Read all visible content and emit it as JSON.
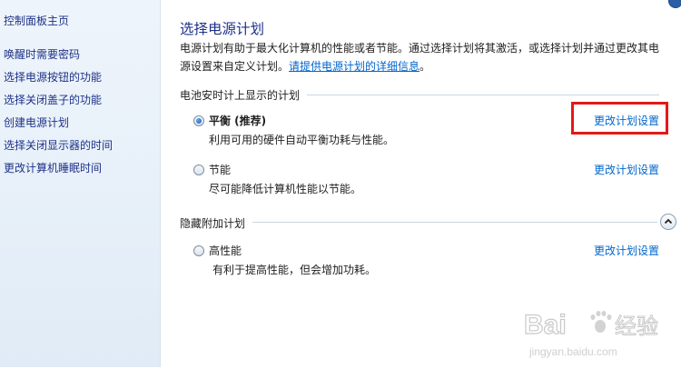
{
  "sidebar": {
    "items": [
      {
        "label": "控制面板主页"
      },
      {
        "label": "唤醒时需要密码"
      },
      {
        "label": "选择电源按钮的功能"
      },
      {
        "label": "选择关闭盖子的功能"
      },
      {
        "label": "创建电源计划"
      },
      {
        "label": "选择关闭显示器的时间"
      },
      {
        "label": "更改计算机睡眠时间"
      }
    ]
  },
  "main": {
    "title": "选择电源计划",
    "description_line1": "电源计划有助于最大化计算机的性能或者节能。通过选择计划将其激活，或选择计划并通过更改其电",
    "description_line2_text": "源设置来自定义计划。",
    "description_link": "请提供电源计划的详细信息"
  },
  "battery_section": {
    "header": "电池安时计上显示的计划",
    "plans": [
      {
        "name": "平衡 (推荐)",
        "desc": "利用可用的硬件自动平衡功耗与性能。",
        "link": "更改计划设置",
        "selected": true
      },
      {
        "name": "节能",
        "desc": "尽可能降低计算机性能以节能。",
        "link": "更改计划设置",
        "selected": false
      }
    ]
  },
  "hidden_section": {
    "header": "隐藏附加计划",
    "plans": [
      {
        "name": "高性能",
        "desc": "有利于提高性能，但会增加功耗。",
        "link": "更改计划设置",
        "selected": false
      }
    ]
  },
  "watermark": {
    "brand": "Bai",
    "brand2": "经验",
    "url": "jingyan.baidu.com"
  },
  "colors": {
    "title": "#1e3287",
    "link": "#0066cc",
    "highlight": "#e31919",
    "sidebar_bg": "#e7f0f9"
  }
}
